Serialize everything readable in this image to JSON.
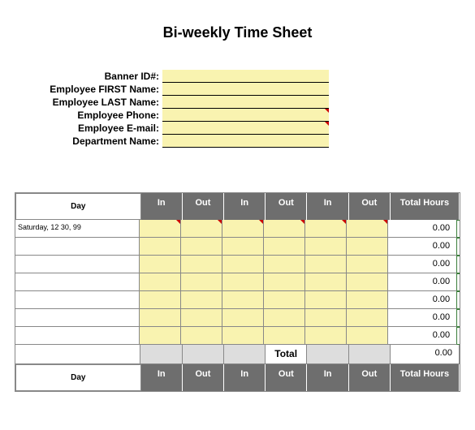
{
  "title": "Bi-weekly Time Sheet",
  "info": {
    "labels": {
      "banner": "Banner ID#:",
      "first": "Employee FIRST Name:",
      "last": "Employee LAST Name:",
      "phone": "Employee Phone:",
      "email": "Employee E-mail:",
      "dept": "Department Name:"
    },
    "values": {
      "banner": "",
      "first": "",
      "last": "",
      "phone": "",
      "email": "",
      "dept": ""
    }
  },
  "headers": {
    "day": "Day",
    "in": "In",
    "out": "Out",
    "total": "Total Hours"
  },
  "rows": [
    {
      "day": "Saturday, 12 30, 99",
      "in1": "",
      "out1": "",
      "in2": "",
      "out2": "",
      "in3": "",
      "out3": "",
      "total": "0.00"
    },
    {
      "day": "",
      "in1": "",
      "out1": "",
      "in2": "",
      "out2": "",
      "in3": "",
      "out3": "",
      "total": "0.00"
    },
    {
      "day": "",
      "in1": "",
      "out1": "",
      "in2": "",
      "out2": "",
      "in3": "",
      "out3": "",
      "total": "0.00"
    },
    {
      "day": "",
      "in1": "",
      "out1": "",
      "in2": "",
      "out2": "",
      "in3": "",
      "out3": "",
      "total": "0.00"
    },
    {
      "day": "",
      "in1": "",
      "out1": "",
      "in2": "",
      "out2": "",
      "in3": "",
      "out3": "",
      "total": "0.00"
    },
    {
      "day": "",
      "in1": "",
      "out1": "",
      "in2": "",
      "out2": "",
      "in3": "",
      "out3": "",
      "total": "0.00"
    },
    {
      "day": "",
      "in1": "",
      "out1": "",
      "in2": "",
      "out2": "",
      "in3": "",
      "out3": "",
      "total": "0.00"
    }
  ],
  "summary": {
    "label": "Total",
    "value": "0.00"
  }
}
